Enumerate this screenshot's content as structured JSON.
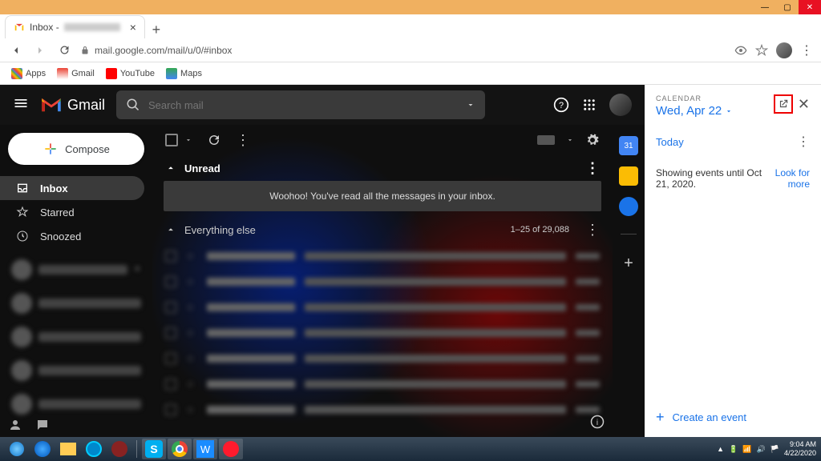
{
  "window": {
    "tab_title": "Inbox -",
    "tab_email": ""
  },
  "browser": {
    "url": "mail.google.com/mail/u/0/#inbox"
  },
  "bookmarks": {
    "apps": "Apps",
    "gmail": "Gmail",
    "youtube": "YouTube",
    "maps": "Maps"
  },
  "gmail": {
    "brand": "Gmail",
    "search": {
      "placeholder": "Search mail"
    },
    "compose": "Compose",
    "nav": {
      "inbox": "Inbox",
      "starred": "Starred",
      "snoozed": "Snoozed"
    },
    "sections": {
      "unread": "Unread",
      "unread_msg": "Woohoo! You've read all the messages in your inbox.",
      "everything": "Everything else",
      "count": "1–25 of 29,088"
    }
  },
  "calendar": {
    "label": "CALENDAR",
    "date": "Wed, Apr 22",
    "today": "Today",
    "showing": "Showing events until Oct 21, 2020.",
    "look": "Look for",
    "more": "more",
    "create": "Create an event"
  },
  "taskbar": {
    "time": "9:04 AM",
    "date": "4/22/2020"
  }
}
